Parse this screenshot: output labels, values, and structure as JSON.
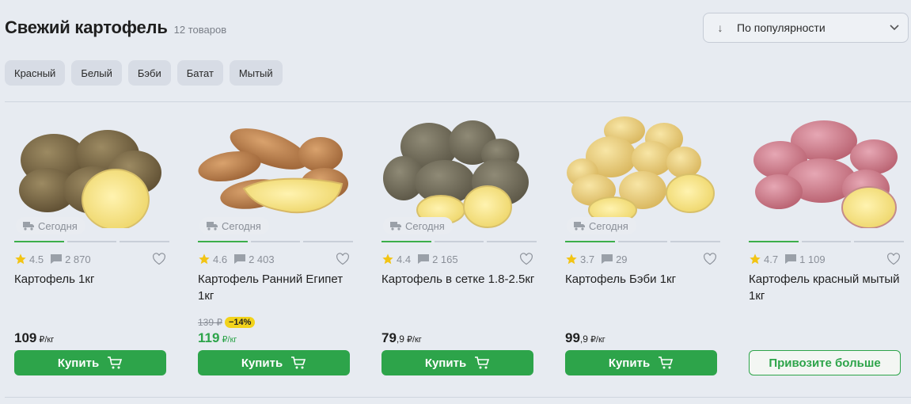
{
  "header": {
    "title": "Свежий картофель",
    "count": "12 товаров"
  },
  "sort": {
    "label": "По популярности"
  },
  "chips": [
    "Красный",
    "Белый",
    "Бэби",
    "Батат",
    "Мытый"
  ],
  "products": [
    {
      "delivery": "Сегодня",
      "rating": "4.5",
      "reviews": "2 870",
      "name": "Картофель 1кг",
      "price_int": "109",
      "price_frac": "",
      "unit": "₽/кг",
      "button": "Купить"
    },
    {
      "delivery": "Сегодня",
      "rating": "4.6",
      "reviews": "2 403",
      "name": "Картофель Ранний Египет 1кг",
      "old_price": "139 ₽",
      "discount": "−14%",
      "price_int": "119",
      "price_frac": "",
      "unit": "₽/кг",
      "button": "Купить"
    },
    {
      "delivery": "Сегодня",
      "rating": "4.4",
      "reviews": "2 165",
      "name": "Картофель в сетке 1.8-2.5кг",
      "price_int": "79",
      "price_frac": ",9",
      "unit": "₽/кг",
      "button": "Купить"
    },
    {
      "delivery": "Сегодня",
      "rating": "3.7",
      "reviews": "29",
      "name": "Картофель Бэби 1кг",
      "price_int": "99",
      "price_frac": ",9",
      "unit": "₽/кг",
      "button": "Купить"
    },
    {
      "rating": "4.7",
      "reviews": "1 109",
      "name": "Картофель красный мытый 1кг",
      "button": "Привозите больше"
    }
  ],
  "colors": {
    "accent": "#2da44a",
    "star": "#f2c414",
    "discount": "#f2d31b"
  },
  "icons": [
    "sort-arrow-icon",
    "chevron-down-icon",
    "delivery-truck-icon",
    "star-icon",
    "comment-icon",
    "heart-icon",
    "cart-icon"
  ]
}
